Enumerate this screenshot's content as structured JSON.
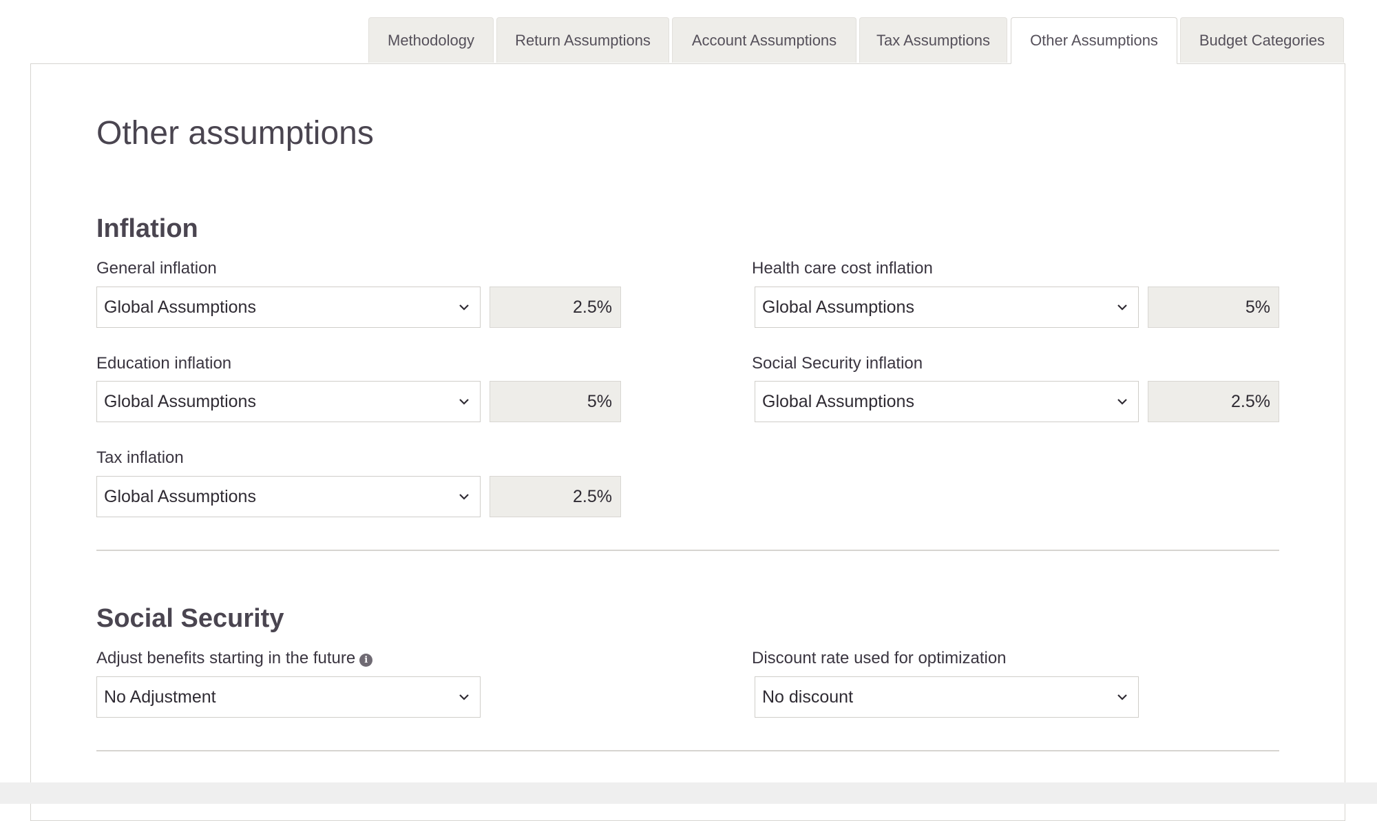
{
  "tabs": [
    {
      "label": "Methodology"
    },
    {
      "label": "Return Assumptions"
    },
    {
      "label": "Account Assumptions"
    },
    {
      "label": "Tax Assumptions"
    },
    {
      "label": "Other Assumptions",
      "active": true
    },
    {
      "label": "Budget Categories"
    }
  ],
  "page": {
    "title": "Other assumptions"
  },
  "inflation": {
    "section_title": "Inflation",
    "general": {
      "label": "General inflation",
      "selected": "Global Assumptions",
      "value": "2.5%"
    },
    "health_care": {
      "label": "Health care cost inflation",
      "selected": "Global Assumptions",
      "value": "5%"
    },
    "education": {
      "label": "Education inflation",
      "selected": "Global Assumptions",
      "value": "5%"
    },
    "social_security": {
      "label": "Social Security inflation",
      "selected": "Global Assumptions",
      "value": "2.5%"
    },
    "tax": {
      "label": "Tax inflation",
      "selected": "Global Assumptions",
      "value": "2.5%"
    }
  },
  "social_security": {
    "section_title": "Social Security",
    "adjust_benefits": {
      "label": "Adjust benefits starting in the future",
      "selected": "No Adjustment"
    },
    "discount_rate": {
      "label": "Discount rate used for optimization",
      "selected": "No discount"
    }
  },
  "icons": {
    "chevron": "chevron-down-icon",
    "info": "info-icon",
    "info_glyph": "i"
  },
  "colors": {
    "tab_bg": "#eeede9",
    "active_tab_bg": "#ffffff",
    "value_box_bg": "#eeede9",
    "text": "#4a4550",
    "border": "#d6d4d0"
  }
}
